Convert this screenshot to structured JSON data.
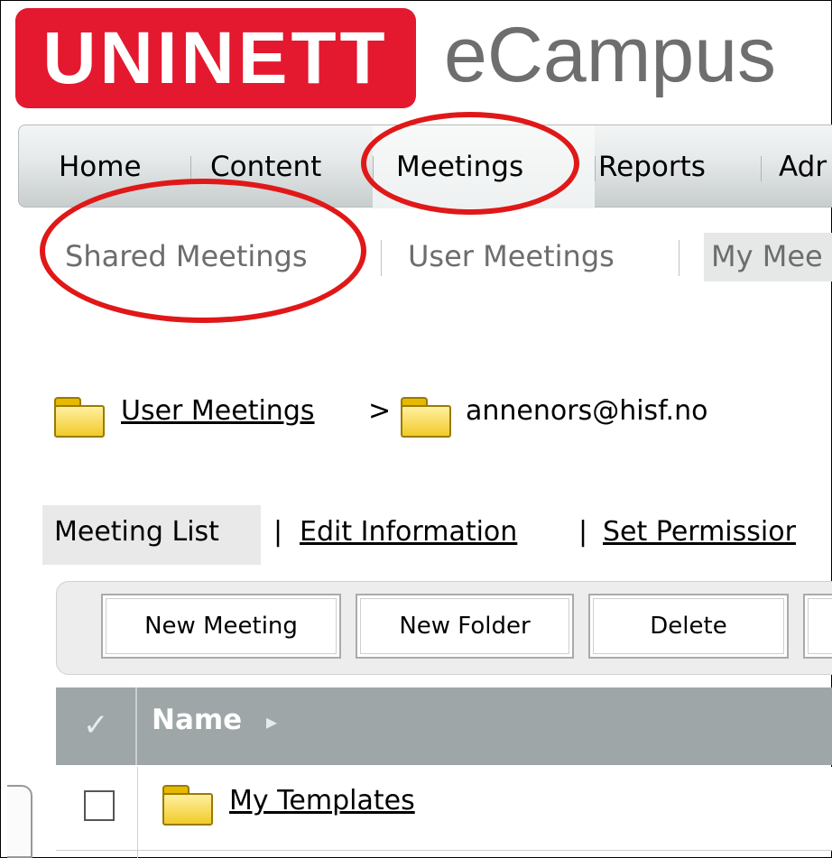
{
  "logo": {
    "brand": "UNINETT",
    "product": "eCampus"
  },
  "main_nav": [
    "Home",
    "Content",
    "Meetings",
    "Reports",
    "Adr"
  ],
  "sub_nav": [
    "Shared Meetings",
    "User Meetings",
    "My Mee"
  ],
  "breadcrumb": {
    "parent": "User Meetings",
    "separator": ">",
    "current": "annenors@hisf.no"
  },
  "content_tabs": {
    "active": "Meeting List",
    "sep": "|",
    "edit": "Edit Information",
    "perms": "Set Permissior"
  },
  "toolbar": {
    "new_meeting": "New Meeting",
    "new_folder": "New Folder",
    "delete": "Delete"
  },
  "table": {
    "check_glyph": "✓",
    "name_header": "Name",
    "sort_glyph": "▸",
    "rows": [
      {
        "name": "My Templates"
      }
    ]
  },
  "colors": {
    "brand_red": "#e4182f",
    "annotation_red": "#e01818",
    "header_gray": "#9ea6a8"
  }
}
